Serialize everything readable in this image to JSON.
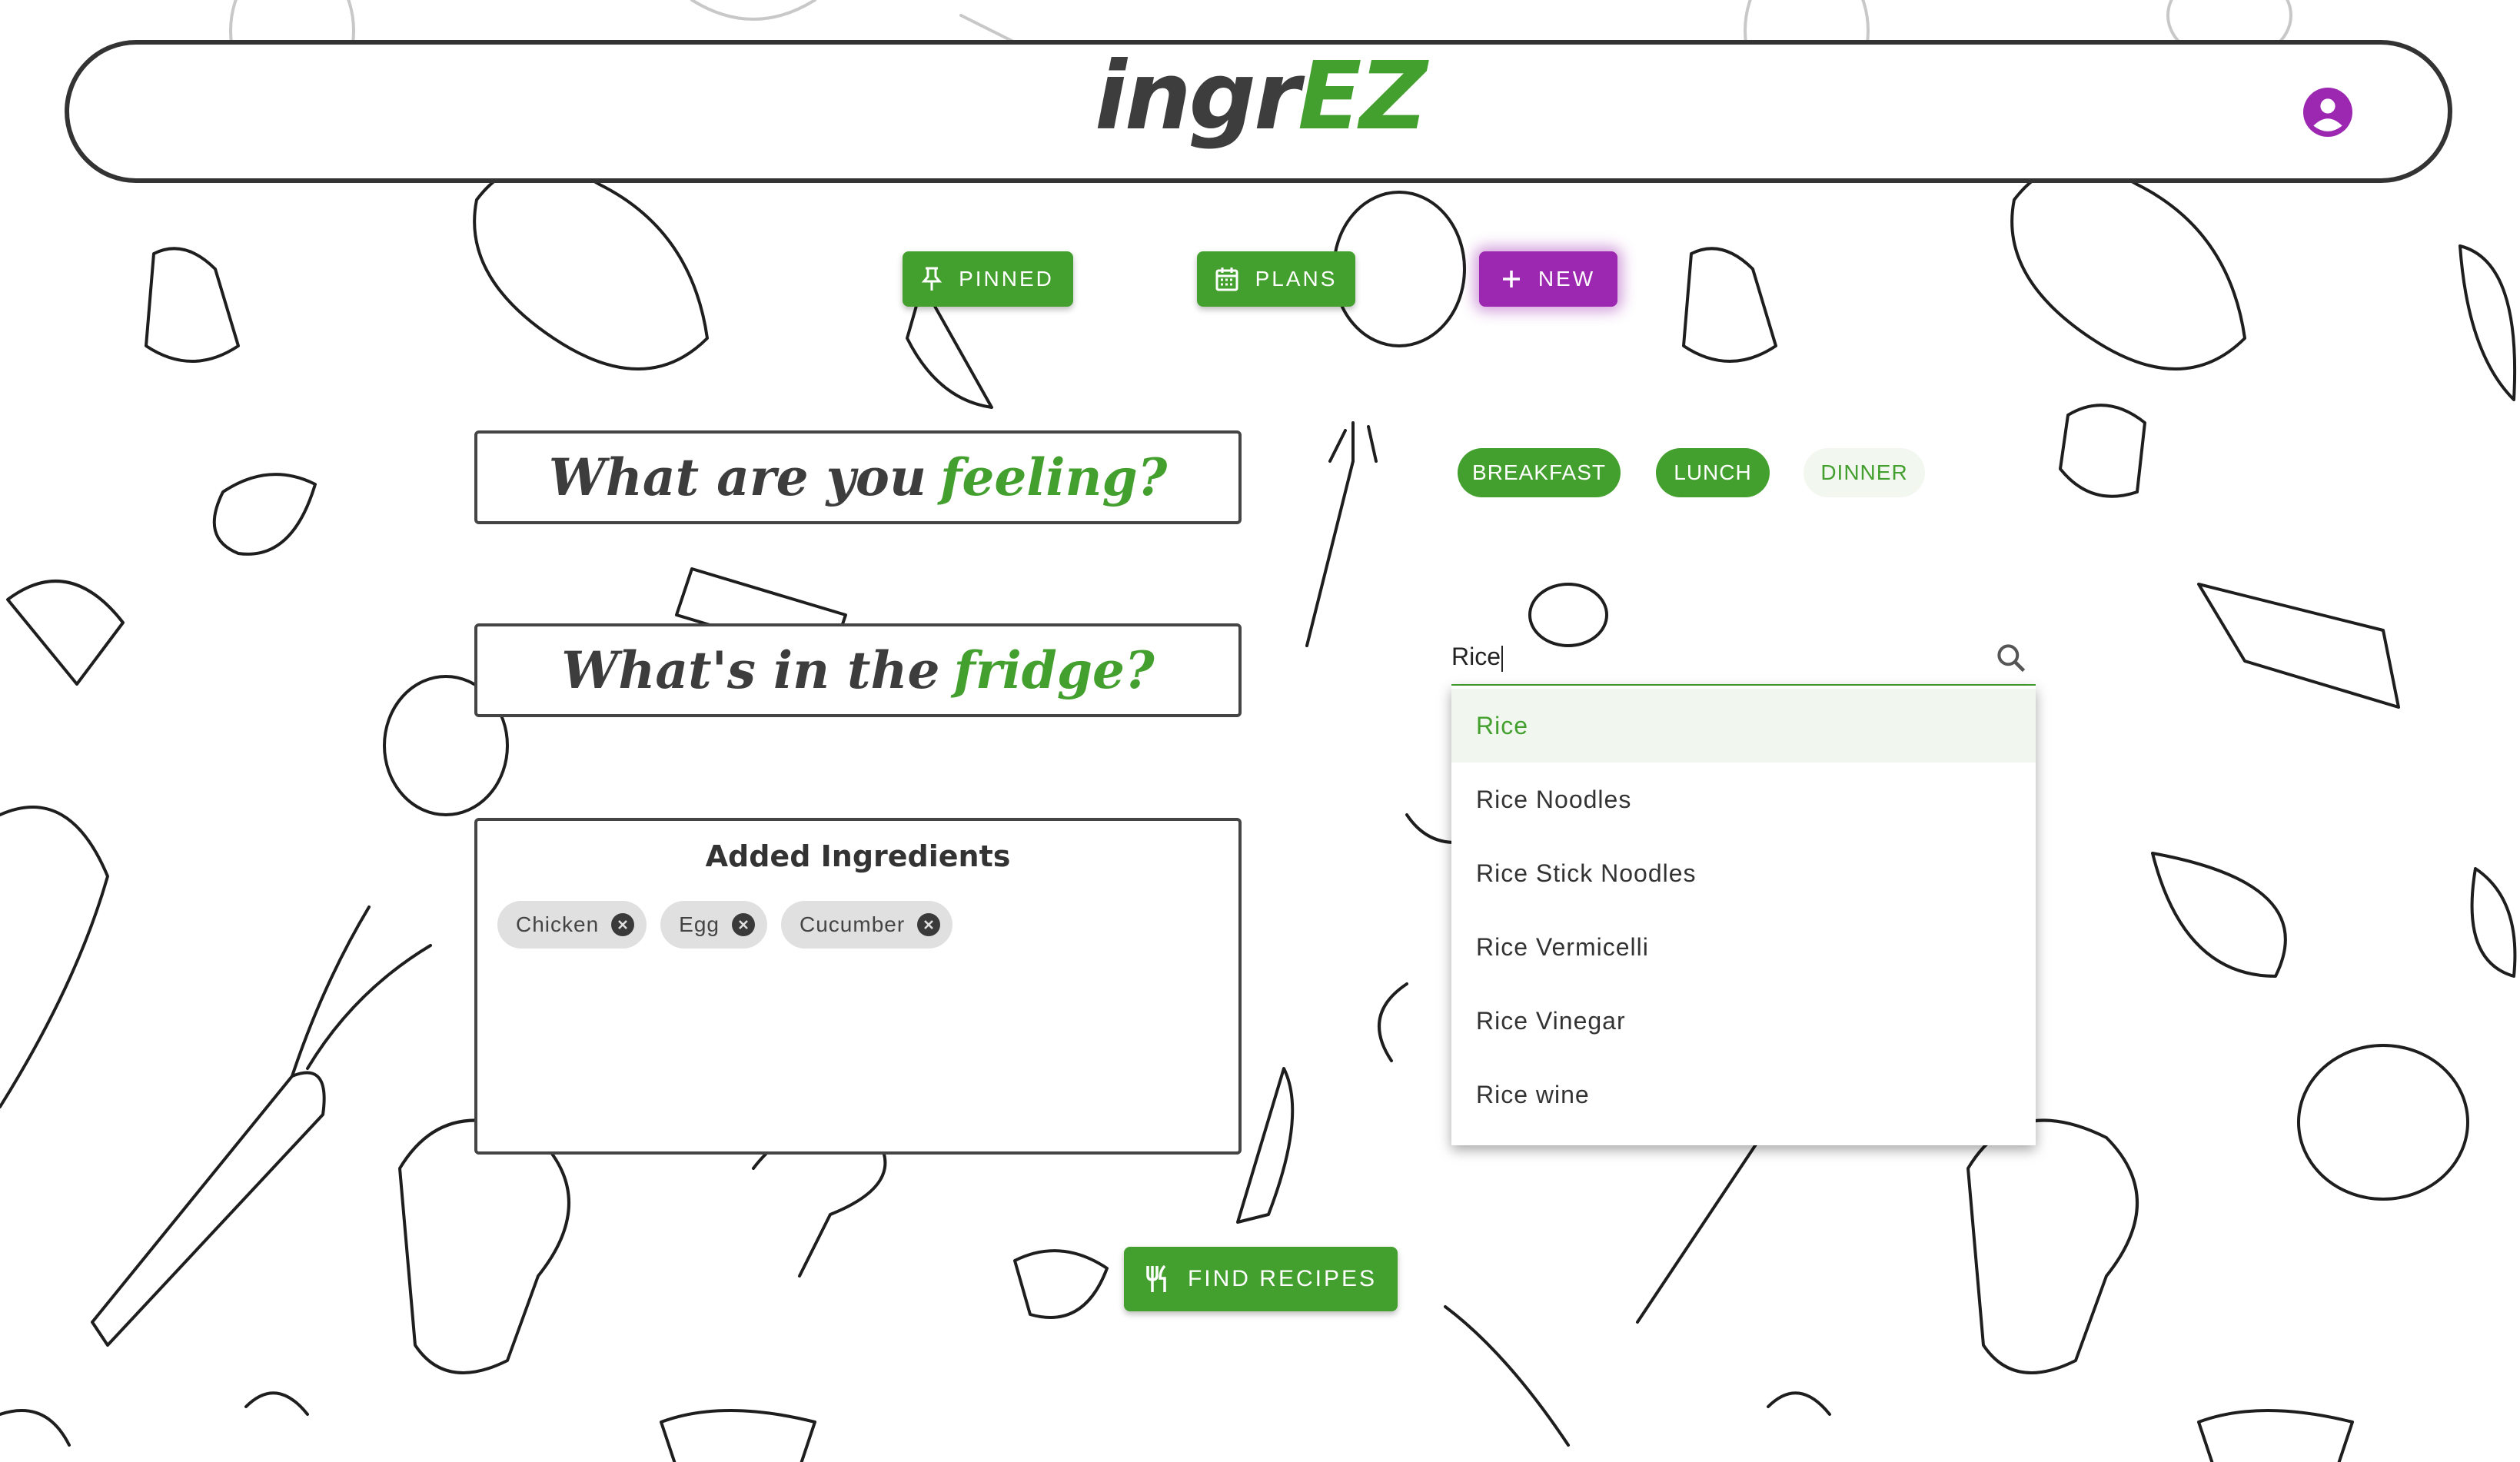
{
  "app": {
    "logo_part1": "ingr",
    "logo_part2": "EZ"
  },
  "header": {
    "account_icon": "account-circle-icon"
  },
  "nav": {
    "pinned_label": "PINNED",
    "plans_label": "PLANS",
    "new_label": "NEW"
  },
  "headings": {
    "feeling_prefix": "What are you",
    "feeling_accent": "feeling?",
    "fridge_prefix": "What's in the",
    "fridge_accent": "fridge?"
  },
  "meals": [
    {
      "label": "BREAKFAST",
      "selected": true
    },
    {
      "label": "LUNCH",
      "selected": true
    },
    {
      "label": "DINNER",
      "selected": false
    }
  ],
  "search": {
    "value": "Rice",
    "icon": "search-icon",
    "suggestions": [
      "Rice",
      "Rice Noodles",
      "Rice Stick Noodles",
      "Rice Vermicelli",
      "Rice Vinegar",
      "Rice wine"
    ],
    "highlighted_index": 0
  },
  "ingredients": {
    "title": "Added Ingredients",
    "items": [
      "Chicken",
      "Egg",
      "Cucumber"
    ]
  },
  "find": {
    "label": "FIND RECIPES",
    "icon": "utensils-icon"
  },
  "colors": {
    "brand_green": "#43a02e",
    "accent_purple": "#9c27b0",
    "text_dark": "#3d3d3d"
  }
}
